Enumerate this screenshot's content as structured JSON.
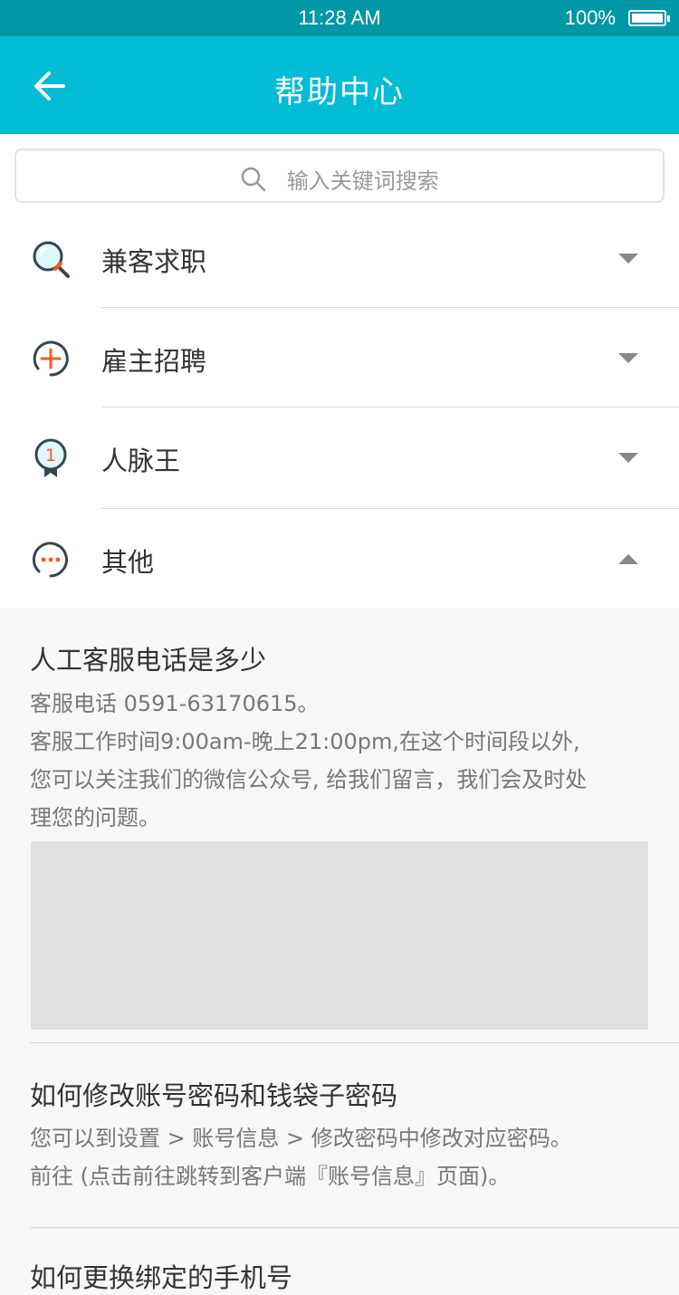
{
  "status_bar": {
    "time": "11:28 AM",
    "battery": "100%"
  },
  "app_bar": {
    "title": "帮助中心"
  },
  "search": {
    "placeholder": "输入关键词搜索"
  },
  "categories": [
    {
      "label": "兼客求职",
      "icon": "search-icon",
      "expanded": false
    },
    {
      "label": "雇主招聘",
      "icon": "plus-circle-icon",
      "expanded": false
    },
    {
      "label": "人脉王",
      "icon": "medal-icon",
      "badge": "1",
      "expanded": false
    },
    {
      "label": "其他",
      "icon": "chat-dots-icon",
      "expanded": true
    }
  ],
  "faqs": [
    {
      "question": "人工客服电话是多少",
      "answer_lines": [
        "客服电话 0591-63170615。",
        "客服工作时间9:00am-晚上21:00pm,在这个时间段以外,",
        "您可以关注我们的微信公众号, 给我们留言，我们会及时处",
        "理您的问题。"
      ]
    },
    {
      "question": "如何修改账号密码和钱袋子密码",
      "answer_lines": [
        "您可以到设置 > 账号信息 > 修改密码中修改对应密码。",
        "前往 (点击前往跳转到客户端『账号信息』页面)。"
      ]
    },
    {
      "question": "如何更换绑定的手机号"
    }
  ],
  "colors": {
    "primary": "#00bcd4",
    "status_bar": "#0097a7",
    "accent": "#ff5722",
    "icon_dark": "#37474f"
  }
}
